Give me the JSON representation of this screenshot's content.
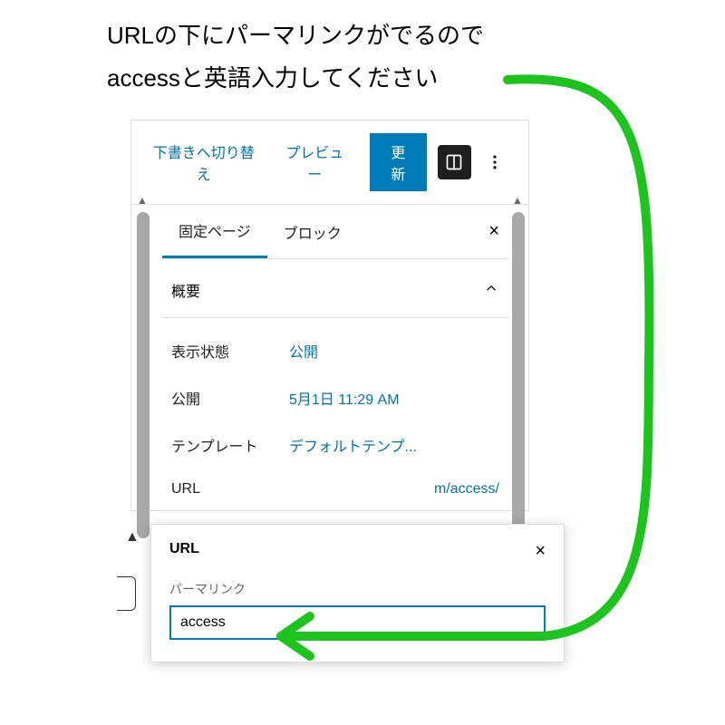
{
  "instruction": {
    "line1": "URLの下にパーマリンクがでるので",
    "line2": "accessと英語入力してください"
  },
  "toolbar": {
    "switch_draft": "下書きへ切り替え",
    "preview": "プレビュー",
    "update": "更新"
  },
  "tabs": {
    "page": "固定ページ",
    "block": "ブロック"
  },
  "overview": {
    "title": "概要",
    "visibility_label": "表示状態",
    "visibility_value": "公開",
    "publish_label": "公開",
    "publish_value": "5月1日 11:29 AM",
    "template_label": "テンプレート",
    "template_value": "デフォルトテンプ...",
    "url_label": "URL",
    "url_value": "m/access/"
  },
  "popup": {
    "title": "URL",
    "permalink_label": "パーマリンク",
    "permalink_value": "access"
  }
}
